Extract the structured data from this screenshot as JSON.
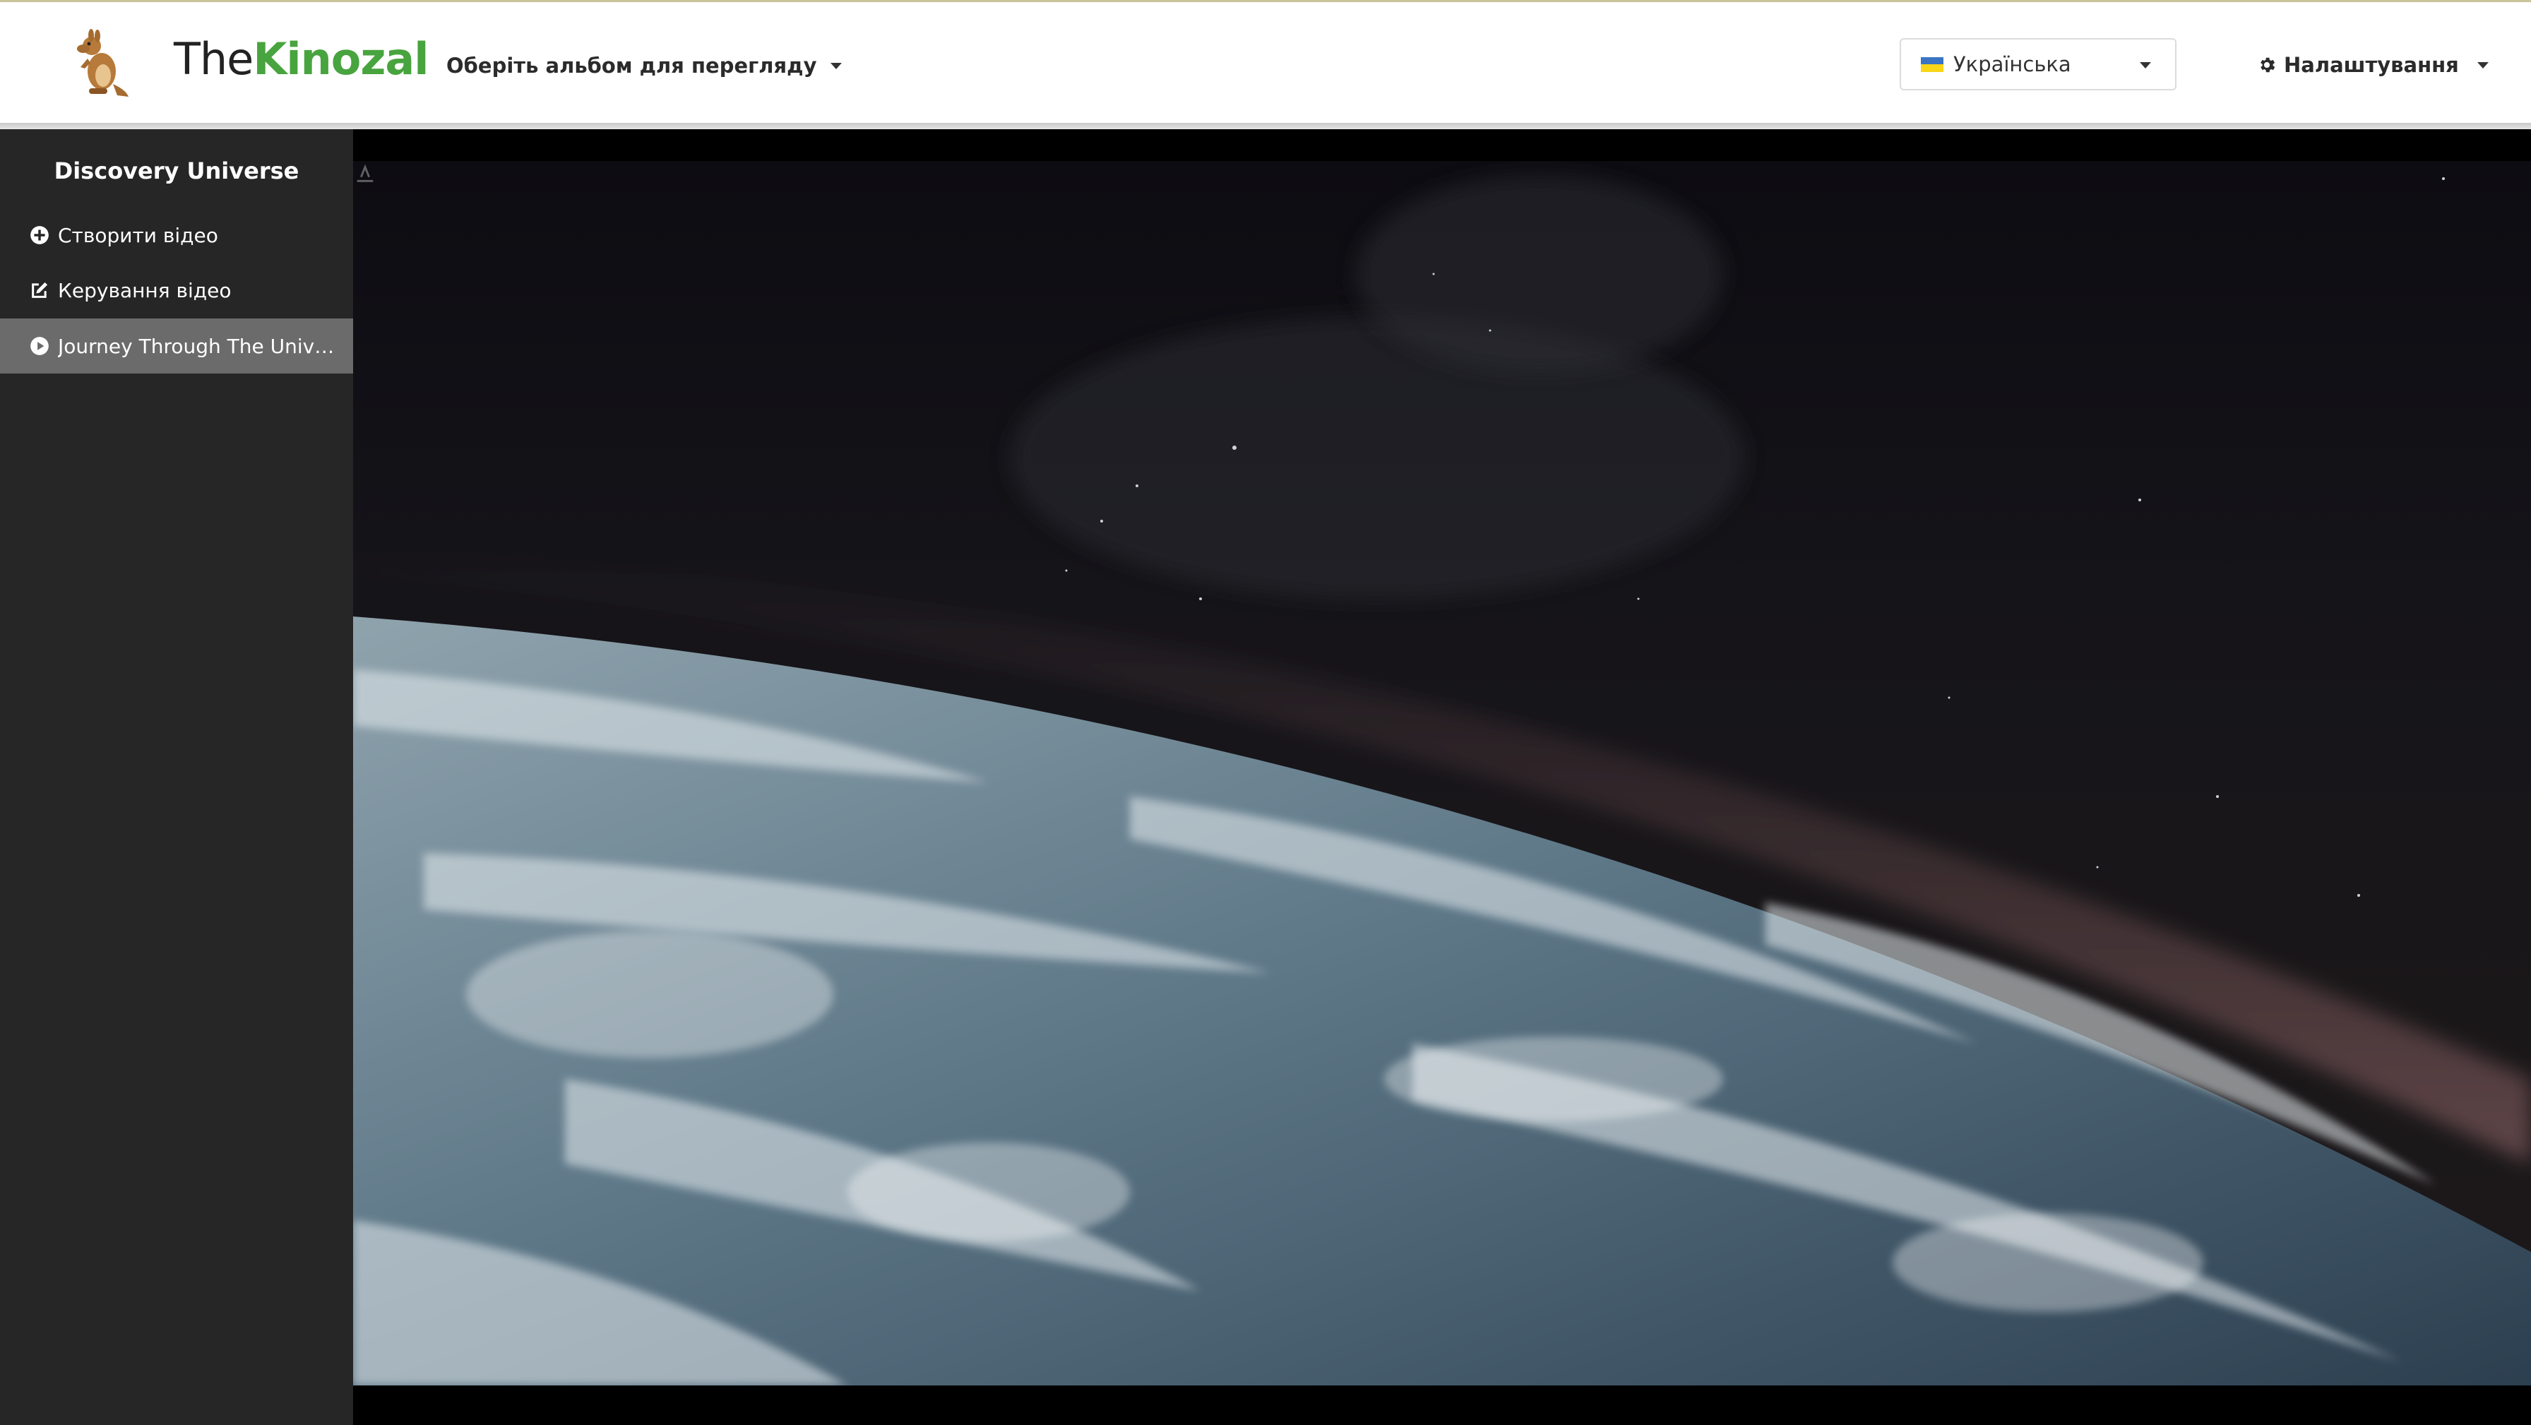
{
  "navbar": {
    "brand_part1": "The",
    "brand_part2": "Kinozal",
    "album_select_label": "Оберіть альбом для перегляду",
    "language": {
      "selected": "Українська",
      "flag_colors": [
        "#3a75c4",
        "#f9d616"
      ]
    },
    "settings_label": "Налаштування"
  },
  "sidebar": {
    "title": "Discovery Universe",
    "items": [
      {
        "label": "Створити відео",
        "icon": "plus-circle-icon"
      },
      {
        "label": "Керування відео",
        "icon": "edit-icon"
      },
      {
        "label": "Journey Through The Universe",
        "icon": "play-circle-icon",
        "active": true
      }
    ]
  },
  "video": {
    "content": "earth-from-orbit"
  },
  "colors": {
    "brand_green": "#48a43e",
    "sidebar_bg": "#262626",
    "active_item_bg": "#6b6b6b"
  }
}
